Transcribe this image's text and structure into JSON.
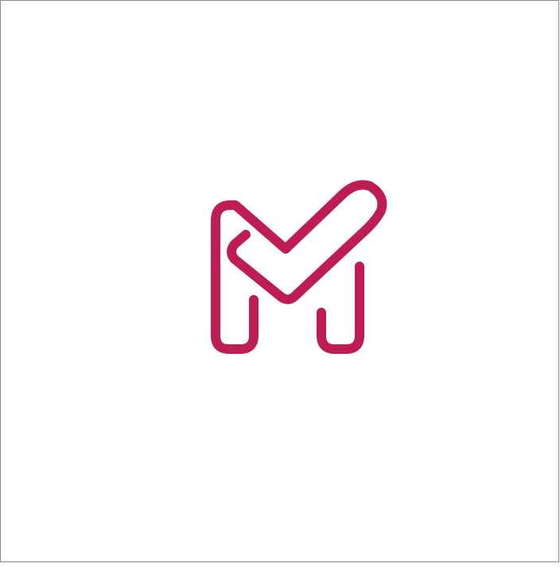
{
  "logo": {
    "icon": "monogram-m-checkmark-icon",
    "color": "#bd1d51",
    "background": "#ffffff",
    "border_color": "#8a8a8a"
  }
}
